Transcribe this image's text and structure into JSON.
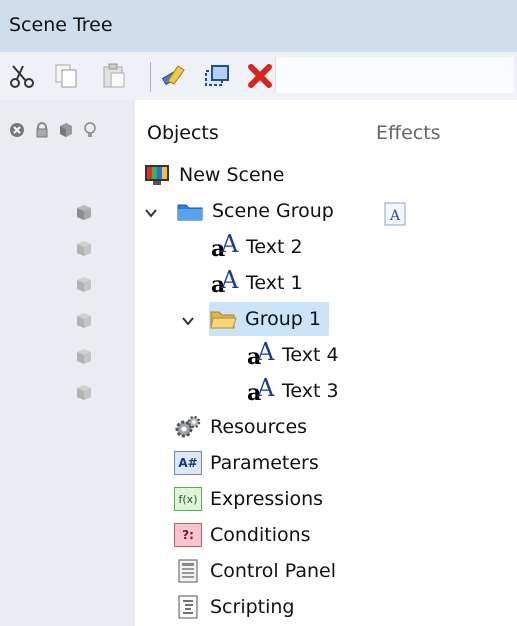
{
  "window": {
    "title": "Scene Tree"
  },
  "toolbar": {
    "buttons": [
      {
        "name": "cut",
        "icon": "scissors-icon"
      },
      {
        "name": "copy",
        "icon": "copy-icon"
      },
      {
        "name": "paste",
        "icon": "paste-icon"
      },
      {
        "name": "rename",
        "icon": "pencil-icon"
      },
      {
        "name": "duplicate",
        "icon": "duplicate-icon"
      },
      {
        "name": "delete",
        "icon": "delete-x-icon"
      }
    ]
  },
  "columns": {
    "objects": "Objects",
    "effects": "Effects",
    "header_icons": [
      "close-circle-icon",
      "lock-icon",
      "cube-icon",
      "lightbulb-icon"
    ]
  },
  "tree": {
    "scene": {
      "label": "New Scene",
      "icon": "scene-icon"
    },
    "scene_group": {
      "label": "Scene Group",
      "icon": "folder-icon",
      "expanded": true,
      "effect_icon": "text-effect-icon"
    },
    "text2": {
      "label": "Text 2",
      "icon": "text-object-icon"
    },
    "text1": {
      "label": "Text 1",
      "icon": "text-object-icon"
    },
    "group1": {
      "label": "Group 1",
      "icon": "folder-open-icon",
      "expanded": true,
      "selected": true
    },
    "text4": {
      "label": "Text 4",
      "icon": "text-object-icon"
    },
    "text3": {
      "label": "Text 3",
      "icon": "text-object-icon"
    },
    "resources": {
      "label": "Resources",
      "icon": "gears-icon"
    },
    "parameters": {
      "label": "Parameters",
      "icon": "parameters-icon",
      "badge": "A#"
    },
    "expressions": {
      "label": "Expressions",
      "icon": "expressions-icon",
      "badge": "f(x)"
    },
    "conditions": {
      "label": "Conditions",
      "icon": "conditions-icon",
      "badge": "?:"
    },
    "control_panel": {
      "label": "Control Panel",
      "icon": "control-panel-icon"
    },
    "scripting": {
      "label": "Scripting",
      "icon": "script-icon"
    }
  },
  "colors": {
    "titlebar": "#cfdceb",
    "selection": "#cce4f7",
    "left_column": "#e9edf2"
  }
}
